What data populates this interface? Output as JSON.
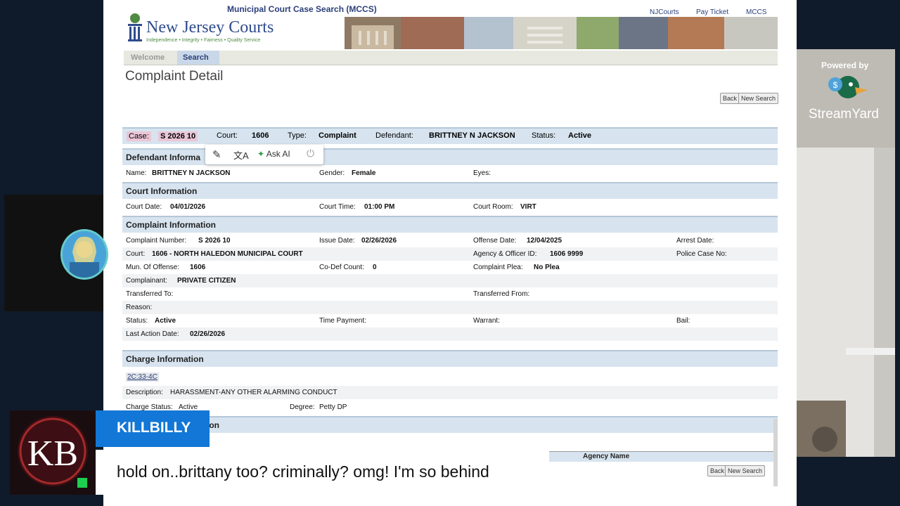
{
  "site": {
    "app_title": "Municipal Court Case Search (MCCS)",
    "logo_title": "New Jersey Courts",
    "logo_subtitle": "Independence • Integrity • Fairness • Quality Service",
    "top_links": [
      "NJCourts",
      "Pay Ticket",
      "MCCS"
    ]
  },
  "tabs": [
    "Welcome",
    "Search"
  ],
  "page": {
    "title": "Complaint Detail",
    "back_label": "Back",
    "new_search_label": "New Search"
  },
  "case_bar": {
    "case_label": "Case:",
    "case_value": "S 2026 10",
    "court_label": "Court:",
    "court_value": "1606",
    "type_label": "Type:",
    "type_value": "Complaint",
    "defendant_label": "Defendant:",
    "defendant_value": "BRITTNEY N JACKSON",
    "status_label": "Status:",
    "status_value": "Active"
  },
  "sections": {
    "defendant": "Defendant Informa",
    "court": "Court Information",
    "complaint": "Complaint Information",
    "charge": "Charge Information",
    "partial": "ion"
  },
  "defendant": {
    "name_label": "Name:",
    "name_value": "BRITTNEY N JACKSON",
    "gender_label": "Gender:",
    "gender_value": "Female",
    "eyes_label": "Eyes:"
  },
  "court_info": {
    "date_label": "Court Date:",
    "date_value": "04/01/2026",
    "time_label": "Court Time:",
    "time_value": "01:00 PM",
    "room_label": "Court Room:",
    "room_value": "VIRT"
  },
  "complaint": {
    "number_label": "Complaint Number:",
    "number_value": "S 2026 10",
    "issue_label": "Issue Date:",
    "issue_value": "02/26/2026",
    "offense_label": "Offense Date:",
    "offense_value": "12/04/2025",
    "arrest_label": "Arrest Date:",
    "court_label": "Court:",
    "court_value": "1606 - NORTH HALEDON MUNICIPAL COURT",
    "agency_label": "Agency & Officer ID:",
    "agency_value": "1606 9999",
    "police_label": "Police Case No:",
    "mun_label": "Mun. Of Offense:",
    "mun_value": "1606",
    "codef_label": "Co-Def Count:",
    "codef_value": "0",
    "plea_label": "Complaint Plea:",
    "plea_value": "No Plea",
    "complainant_label": "Complainant:",
    "complainant_value": "PRIVATE CITIZEN",
    "transferred_to_label": "Transferred To:",
    "transferred_from_label": "Transferred From:",
    "reason_label": "Reason:",
    "status_label": "Status:",
    "status_value": "Active",
    "time_payment_label": "Time Payment:",
    "warrant_label": "Warrant:",
    "bail_label": "Bail:",
    "last_action_label": "Last Action Date:",
    "last_action_value": "02/26/2026"
  },
  "charge": {
    "statute": "2C:33-4C",
    "desc_label": "Description:",
    "desc_value": "HARASSMENT-ANY OTHER ALARMING CONDUCT",
    "status_label": "Charge Status:",
    "status_value": "Active",
    "degree_label": "Degree:",
    "degree_value": "Petty DP"
  },
  "table_header": {
    "agency_name": "Agency Name"
  },
  "ai_toolbar": {
    "ask_ai": "Ask AI"
  },
  "stream": {
    "powered_by": "Powered by",
    "brand": "StreamYard",
    "chat_name": "KILLBILLY",
    "chat_message": "hold on..brittany too? criminally? omg! I'm so behind",
    "logo_text": "KB"
  },
  "colors": {
    "accent": "#1277d6",
    "section_bar": "#d7e4ef",
    "case_highlight": "#eac6d6"
  }
}
